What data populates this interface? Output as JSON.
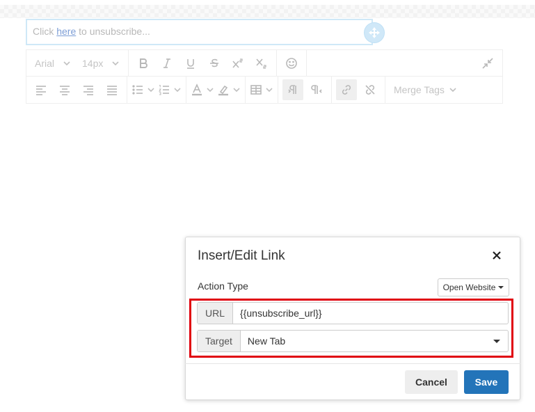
{
  "editor": {
    "text_before": "Click ",
    "link_text": "here",
    "text_after": " to unsubscribe..."
  },
  "toolbar": {
    "font_family": "Arial",
    "font_size": "14px",
    "merge_tags_label": "Merge Tags"
  },
  "modal": {
    "title": "Insert/Edit Link",
    "action_type_label": "Action Type",
    "action_type_value": "Open Website",
    "url_label": "URL",
    "url_value": "{{unsubscribe_url}}",
    "target_label": "Target",
    "target_value": "New Tab",
    "cancel_label": "Cancel",
    "save_label": "Save"
  },
  "colors": {
    "highlight_border": "#e0000d",
    "save_button": "#2374b9",
    "editor_border": "#cfe8f7"
  }
}
